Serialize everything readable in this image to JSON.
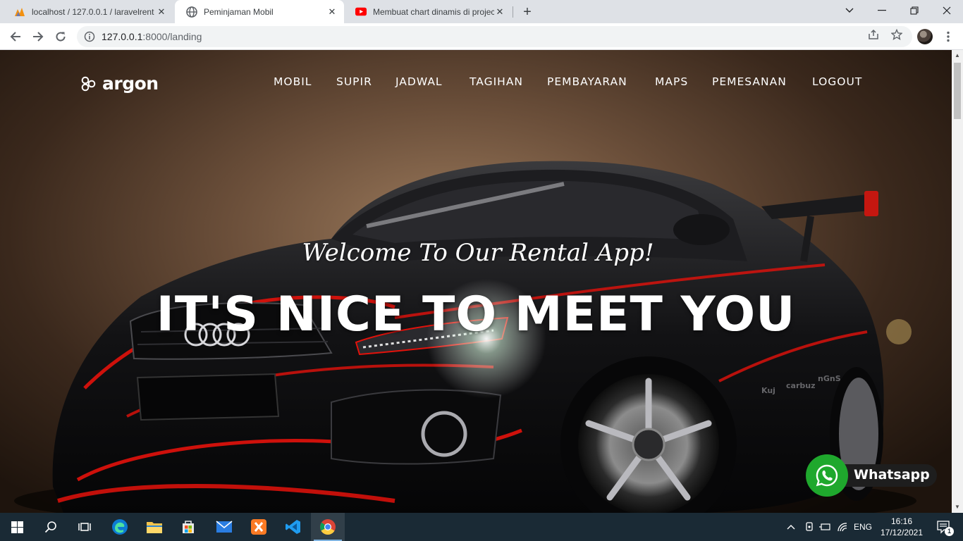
{
  "browser": {
    "tabs": [
      {
        "title": "localhost / 127.0.0.1 / laravelrent",
        "favicon": "phpmyadmin-icon",
        "active": false
      },
      {
        "title": "Peminjaman Mobil",
        "favicon": "globe-icon",
        "active": true
      },
      {
        "title": "Membuat chart dinamis di project",
        "favicon": "youtube-icon",
        "active": false
      }
    ],
    "address": {
      "host": "127.0.0.1",
      "path": ":8000/landing"
    }
  },
  "page": {
    "brand": "argon",
    "nav": [
      {
        "label": "MOBIL"
      },
      {
        "label": "SUPIR"
      },
      {
        "label": "JADWAL"
      },
      {
        "label": "TAGIHAN"
      },
      {
        "label": "PEMBAYARAN"
      },
      {
        "label": "MAPS"
      },
      {
        "label": "PEMESANAN"
      },
      {
        "label": "LOGOUT"
      }
    ],
    "lead": "Welcome To Our Rental App!",
    "heading": "IT'S NICE TO MEET YOU",
    "whatsapp_label": "Whatsapp"
  },
  "taskbar": {
    "language": "ENG",
    "time": "16:16",
    "date": "17/12/2021",
    "notification_count": "1"
  },
  "colors": {
    "whatsapp_green": "#1fa82d",
    "car_accent_red": "#e3120b",
    "taskbar_bg": "#1a2a35"
  }
}
